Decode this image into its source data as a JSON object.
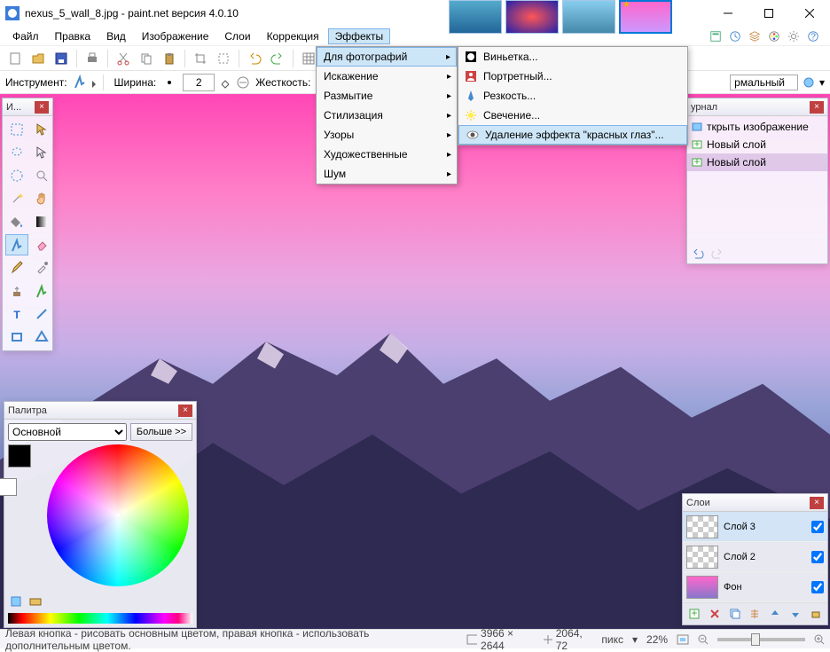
{
  "title": "nexus_5_wall_8.jpg - paint.net версия 4.0.10",
  "menubar": {
    "items": [
      "Файл",
      "Правка",
      "Вид",
      "Изображение",
      "Слои",
      "Коррекция",
      "Эффекты"
    ],
    "activeIndex": 6
  },
  "toolopts": {
    "instrument_label": "Инструмент:",
    "width_label": "Ширина:",
    "width_value": "2",
    "hardness_label": "Жесткость:",
    "blend_mode": "рмальный"
  },
  "effects_menu": {
    "items": [
      {
        "label": "Для фотографий",
        "sub": true,
        "hover": true
      },
      {
        "label": "Искажение",
        "sub": true
      },
      {
        "label": "Размытие",
        "sub": true
      },
      {
        "label": "Стилизация",
        "sub": true
      },
      {
        "label": "Узоры",
        "sub": true
      },
      {
        "label": "Художественные",
        "sub": true
      },
      {
        "label": "Шум",
        "sub": true
      }
    ]
  },
  "photo_submenu": {
    "items": [
      {
        "label": "Виньетка...",
        "icon": "vignette"
      },
      {
        "label": "Портретный...",
        "icon": "portrait"
      },
      {
        "label": "Резкость...",
        "icon": "sharpen"
      },
      {
        "label": "Свечение...",
        "icon": "glow"
      },
      {
        "label": "Удаление эффекта \"красных глаз\"...",
        "icon": "redeye",
        "hover": true
      }
    ]
  },
  "tools_panel": {
    "title": "И..."
  },
  "palette_panel": {
    "title": "Палитра",
    "mode": "Основной",
    "more": "Больше >>"
  },
  "history_panel": {
    "title": "урнал",
    "items": [
      {
        "label": "ткрыть изображение"
      },
      {
        "label": "Новый слой"
      },
      {
        "label": "Новый слой",
        "sel": true
      }
    ]
  },
  "layers_panel": {
    "title": "Слои",
    "items": [
      {
        "name": "Слой 3",
        "checked": true,
        "thumb": "trans",
        "sel": true
      },
      {
        "name": "Слой 2",
        "checked": true,
        "thumb": "trans"
      },
      {
        "name": "Фон",
        "checked": true,
        "thumb": "img"
      }
    ]
  },
  "statusbar": {
    "hint": "Левая кнопка - рисовать основным цветом, правая кнопка - использовать дополнительным цветом.",
    "dims": "3966 × 2644",
    "pos": "2064, 72",
    "unit": "пикс",
    "zoom": "22%"
  }
}
